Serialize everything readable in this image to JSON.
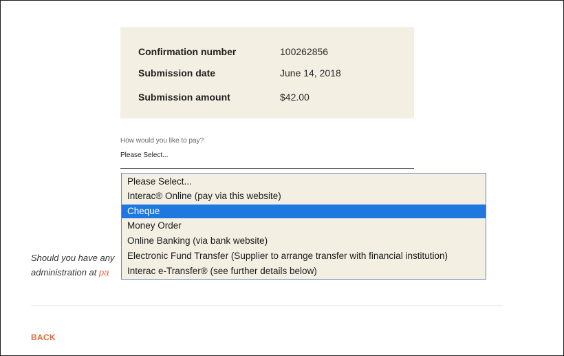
{
  "summary": {
    "confirmation_label": "Confirmation number",
    "confirmation_value": "100262856",
    "date_label": "Submission date",
    "date_value": "June 14, 2018",
    "amount_label": "Submission amount",
    "amount_value": "$42.00"
  },
  "payment": {
    "question": "How would you like to pay?",
    "current_selection": "Please Select...",
    "options": [
      "Please Select...",
      "Interac® Online (pay via this website)",
      "Cheque",
      "Money Order",
      "Online Banking (via bank website)",
      "Electronic Fund Transfer (Supplier to arrange transfer with financial institution)",
      "Interac e-Transfer® (see further details below)"
    ],
    "highlighted_option": "Cheque"
  },
  "info": {
    "line1": "Should you have any",
    "line2": "administration at",
    "email_partial": "pa"
  },
  "nav": {
    "back_label": "BACK"
  },
  "colors": {
    "box_background": "#f4efe3",
    "accent": "#e0683a",
    "selection": "#1e78e0"
  }
}
